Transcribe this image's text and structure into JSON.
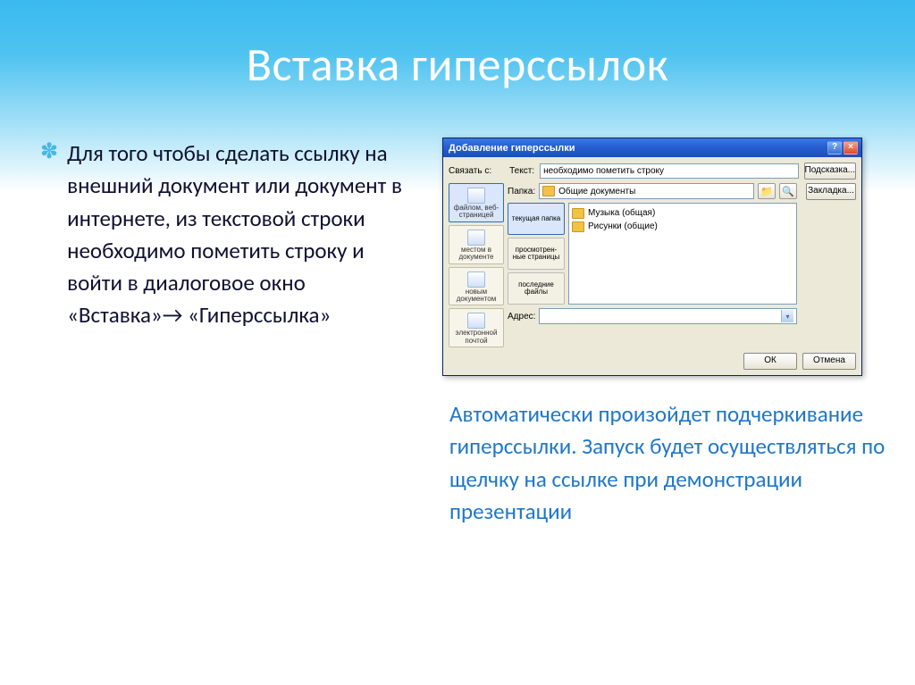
{
  "slide": {
    "title": "Вставка гиперссылок",
    "para1": "Для того чтобы сделать ссылку на внешний документ или документ в интернете,  из текстовой строки необходимо пометить строку   и войти в диалоговое окно «Вставка»→ «Гиперссылка»",
    "para2": "Автоматически произойдет подчеркивание гиперссылки.  Запуск будет осуществляться по щелчку на ссылке при демонстрации презентации"
  },
  "dialog": {
    "title": "Добавление гиперссылки",
    "link_with_label": "Связать с:",
    "text_label": "Текст:",
    "text_value": "необходимо пометить строку",
    "hint_btn": "Подсказка...",
    "bookmark_btn": "Закладка...",
    "folder_label": "Папка:",
    "folder_value": "Общие документы",
    "address_label": "Адрес:",
    "ok_btn": "ОК",
    "cancel_btn": "Отмена",
    "sidebar": [
      "файлом, веб-страницей",
      "местом в документе",
      "новым документом",
      "электронной почтой"
    ],
    "mid_tabs": [
      "текущая папка",
      "просмотрен-ные страницы",
      "последние файлы"
    ],
    "files": [
      "Музыка (общая)",
      "Рисунки (общие)"
    ]
  }
}
